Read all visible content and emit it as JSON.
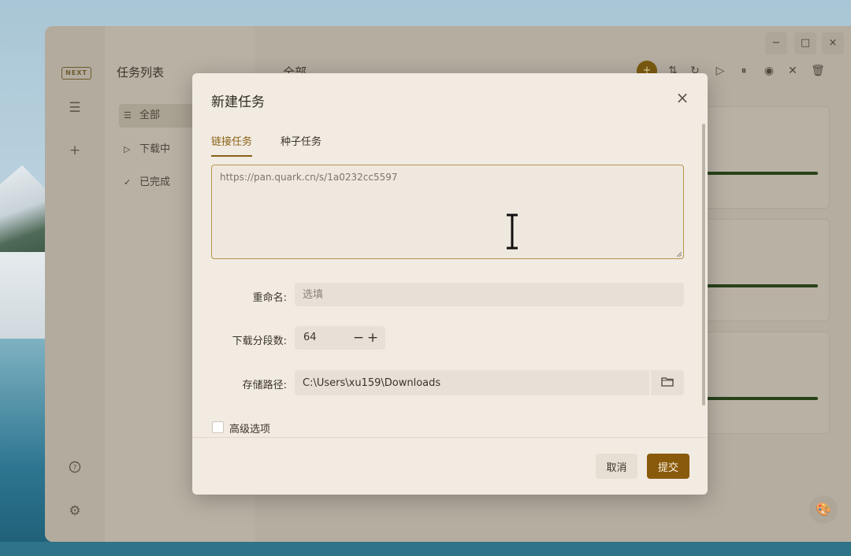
{
  "rail": {
    "logo": "NEXT",
    "icons": [
      "list-icon",
      "plus-icon",
      "help-icon",
      "gear-icon"
    ]
  },
  "sidebar": {
    "title": "任务列表",
    "items": [
      {
        "label": "全部",
        "icon": "list-icon",
        "active": true
      },
      {
        "label": "下载中",
        "icon": "play-icon"
      },
      {
        "label": "已完成",
        "icon": "check-icon"
      }
    ]
  },
  "main": {
    "title": "全部"
  },
  "window_controls": {
    "minimize": "−",
    "maximize": "□",
    "close": "×"
  },
  "modal": {
    "title": "新建任务",
    "tabs": [
      {
        "label": "链接任务",
        "active": true
      },
      {
        "label": "种子任务"
      }
    ],
    "url_value": "https://pan.quark.cn/s/1a0232cc5597",
    "rename_label": "重命名:",
    "rename_placeholder": "选填",
    "segments_label": "下载分段数:",
    "segments_value": "64",
    "path_label": "存储路径:",
    "path_value": "C:\\Users\\xu159\\Downloads",
    "advanced_label": "高级选项",
    "cancel_label": "取消",
    "submit_label": "提交"
  },
  "colors": {
    "accent": "#8a6216",
    "submit": "#8a5a0c",
    "progress": "#28421a"
  }
}
